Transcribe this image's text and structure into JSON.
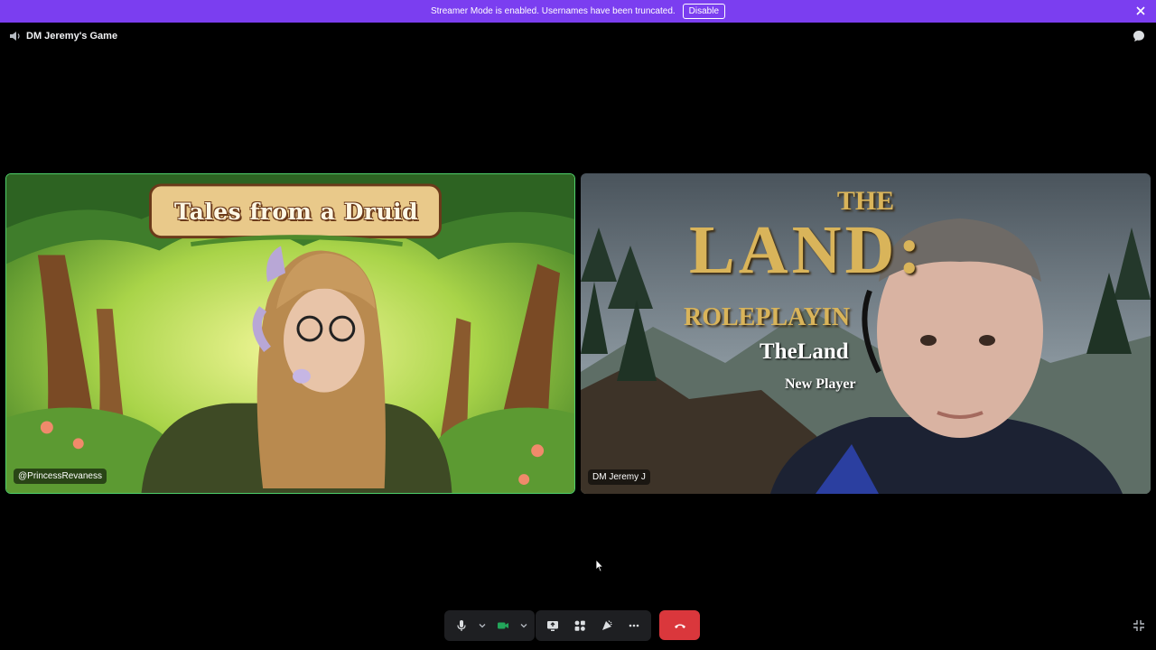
{
  "banner": {
    "text": "Streamer Mode is enabled. Usernames have been truncated.",
    "button_label": "Disable",
    "color": "#7b3ef0"
  },
  "header": {
    "channel_name": "DM Jeremy's Game",
    "icons": [
      "speaker-icon",
      "chat-icon"
    ]
  },
  "tiles": [
    {
      "username": "@PrincessRevaness",
      "stream_title": "Tales from a Druid",
      "speaking": true,
      "border_color": "#4fd06b"
    },
    {
      "username": "DM Jeremy J",
      "overlay": {
        "line1": "THE",
        "line2": "LAND:",
        "line3": "ROLEPLAYIN",
        "line3b": "M",
        "line4": "TheLand",
        "line5": "New Player"
      }
    }
  ],
  "controls": {
    "icons": [
      "microphone-icon",
      "chevron-down-icon",
      "camera-icon",
      "chevron-down-icon",
      "screen-share-icon",
      "activities-icon",
      "soundboard-icon",
      "more-icon",
      "hang-up-icon",
      "fullscreen-exit-icon"
    ],
    "end_call_color": "#da373c",
    "camera_active_color": "#23a55a"
  }
}
